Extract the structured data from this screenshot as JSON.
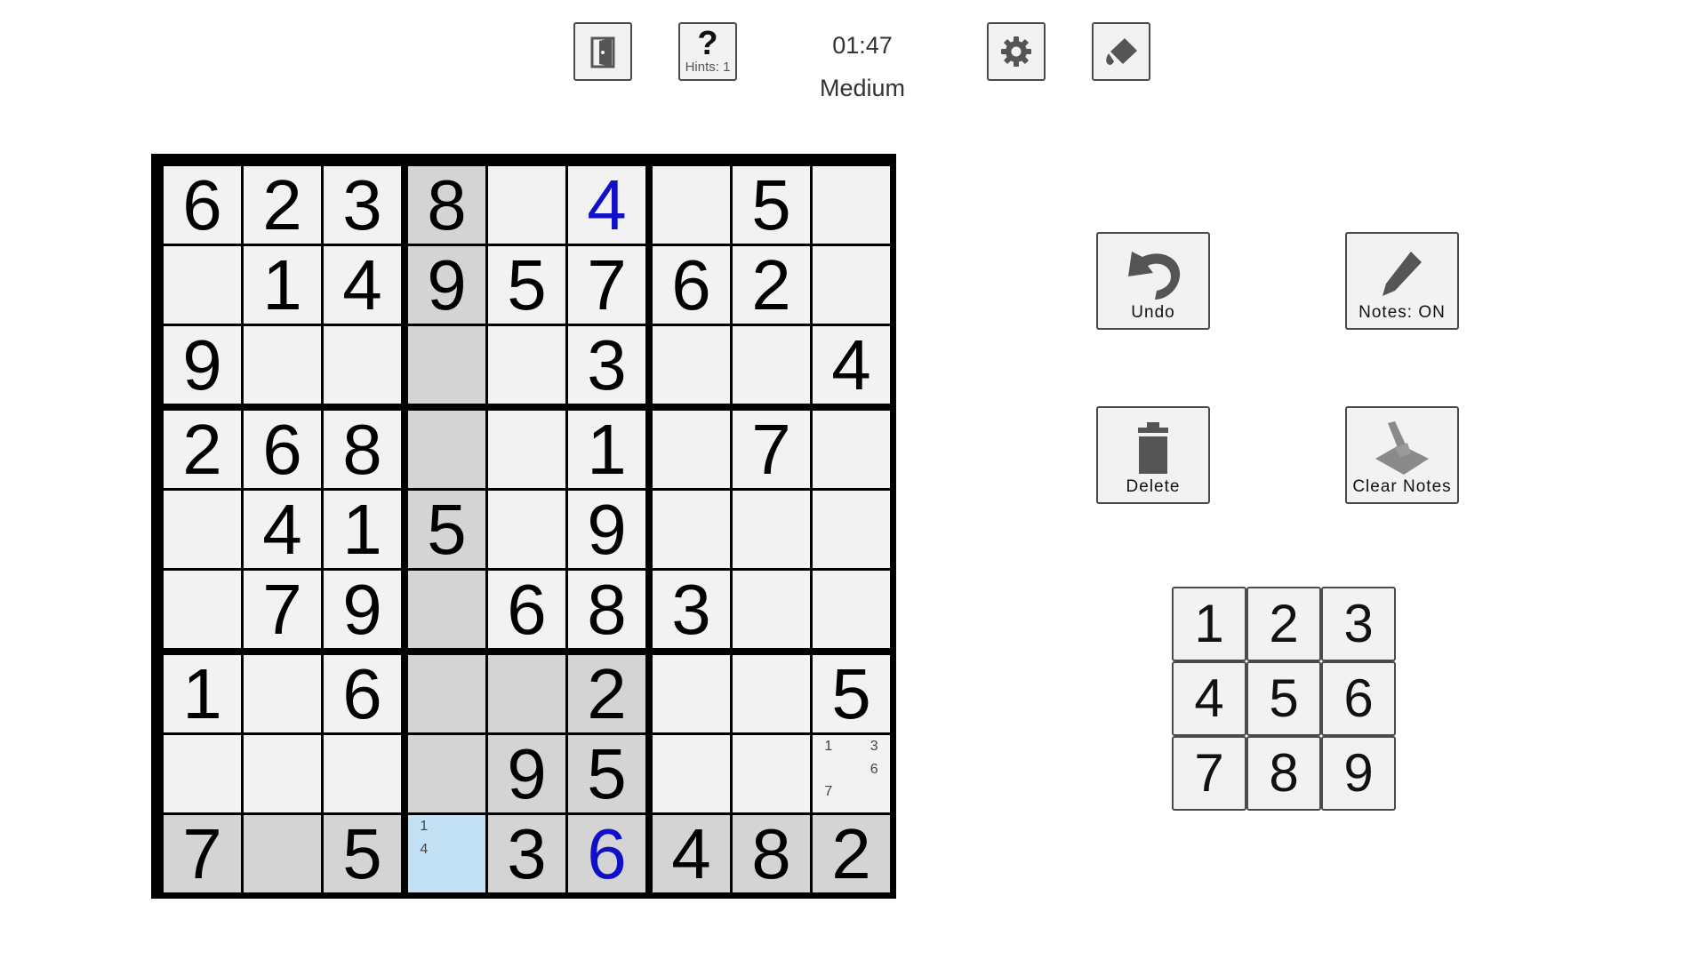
{
  "header": {
    "exit_icon": "door-exit-icon",
    "hint_symbol": "?",
    "hint_label": "Hints: 1",
    "timer": "01:47",
    "difficulty": "Medium",
    "settings_icon": "gear-icon",
    "theme_icon": "paint-bucket-icon"
  },
  "actions": {
    "undo_label": "Undo",
    "notes_label": "Notes: ON",
    "delete_label": "Delete",
    "clear_notes_label": "Clear Notes"
  },
  "numpad": [
    "1",
    "2",
    "3",
    "4",
    "5",
    "6",
    "7",
    "8",
    "9"
  ],
  "colors": {
    "cell_bg": "#f2f2f2",
    "highlight_bg": "#d4d4d4",
    "selected_bg": "#c2e1f5",
    "user_digit": "#1010c8",
    "border": "#000000"
  },
  "board": [
    [
      {
        "v": "6"
      },
      {
        "v": "2"
      },
      {
        "v": "3"
      },
      {
        "v": "8",
        "hl": true
      },
      {
        "v": ""
      },
      {
        "v": "4",
        "user": true
      },
      {
        "v": ""
      },
      {
        "v": "5"
      },
      {
        "v": ""
      }
    ],
    [
      {
        "v": ""
      },
      {
        "v": "1"
      },
      {
        "v": "4"
      },
      {
        "v": "9",
        "hl": true
      },
      {
        "v": "5"
      },
      {
        "v": "7"
      },
      {
        "v": "6"
      },
      {
        "v": "2"
      },
      {
        "v": ""
      }
    ],
    [
      {
        "v": "9"
      },
      {
        "v": ""
      },
      {
        "v": ""
      },
      {
        "v": "",
        "hl": true
      },
      {
        "v": ""
      },
      {
        "v": "3"
      },
      {
        "v": ""
      },
      {
        "v": ""
      },
      {
        "v": "4"
      }
    ],
    [
      {
        "v": "2"
      },
      {
        "v": "6"
      },
      {
        "v": "8"
      },
      {
        "v": "",
        "hl": true
      },
      {
        "v": ""
      },
      {
        "v": "1"
      },
      {
        "v": ""
      },
      {
        "v": "7"
      },
      {
        "v": ""
      }
    ],
    [
      {
        "v": ""
      },
      {
        "v": "4"
      },
      {
        "v": "1"
      },
      {
        "v": "5",
        "hl": true
      },
      {
        "v": ""
      },
      {
        "v": "9"
      },
      {
        "v": ""
      },
      {
        "v": ""
      },
      {
        "v": ""
      }
    ],
    [
      {
        "v": ""
      },
      {
        "v": "7"
      },
      {
        "v": "9"
      },
      {
        "v": "",
        "hl": true
      },
      {
        "v": "6"
      },
      {
        "v": "8"
      },
      {
        "v": "3"
      },
      {
        "v": ""
      },
      {
        "v": ""
      }
    ],
    [
      {
        "v": "1"
      },
      {
        "v": ""
      },
      {
        "v": "6"
      },
      {
        "v": "",
        "hl": true
      },
      {
        "v": "",
        "hl": true
      },
      {
        "v": "2",
        "hl": true
      },
      {
        "v": ""
      },
      {
        "v": ""
      },
      {
        "v": "5"
      }
    ],
    [
      {
        "v": ""
      },
      {
        "v": ""
      },
      {
        "v": ""
      },
      {
        "v": "",
        "hl": true
      },
      {
        "v": "9",
        "hl": true
      },
      {
        "v": "5",
        "hl": true
      },
      {
        "v": ""
      },
      {
        "v": ""
      },
      {
        "v": "",
        "notes": [
          "1",
          "",
          "3",
          "",
          "",
          "6",
          "7",
          "",
          ""
        ]
      }
    ],
    [
      {
        "v": "7",
        "hl": true
      },
      {
        "v": "",
        "hl": true
      },
      {
        "v": "5",
        "hl": true
      },
      {
        "v": "",
        "sel": true,
        "notes": [
          "1",
          "",
          "",
          "4",
          "",
          "",
          "",
          "",
          ""
        ]
      },
      {
        "v": "3",
        "hl": true
      },
      {
        "v": "6",
        "hl": true,
        "user": true
      },
      {
        "v": "4",
        "hl": true
      },
      {
        "v": "8",
        "hl": true
      },
      {
        "v": "2",
        "hl": true
      }
    ]
  ]
}
